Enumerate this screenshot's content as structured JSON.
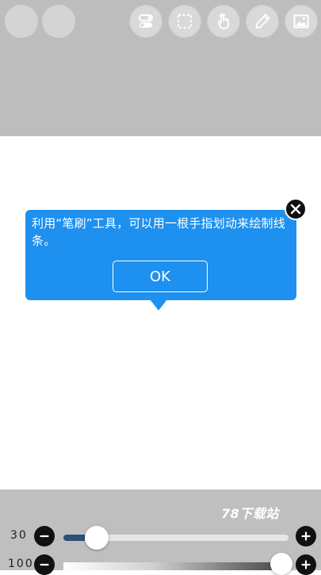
{
  "toolbar": {
    "left_buttons": [
      "undo-placeholder",
      "redo-placeholder"
    ],
    "tools": [
      "layers-toggle-icon",
      "selection-icon",
      "finger-tap-icon",
      "brush-icon",
      "image-icon"
    ]
  },
  "tooltip": {
    "message": "利用“笔刷”工具，可以用一根手指划动来绘制线条。",
    "ok_label": "OK"
  },
  "watermark": "78下载站",
  "sliders": {
    "size": {
      "label": "30",
      "value": 30,
      "fraction": 0.06
    },
    "opacity": {
      "label": "100",
      "value": 100,
      "fraction": 0.97
    }
  },
  "colors": {
    "toolbar_bg": "#bdbdbd",
    "tooltip_bg": "#1e90ef",
    "slider_fill": "#2d4f7a"
  }
}
